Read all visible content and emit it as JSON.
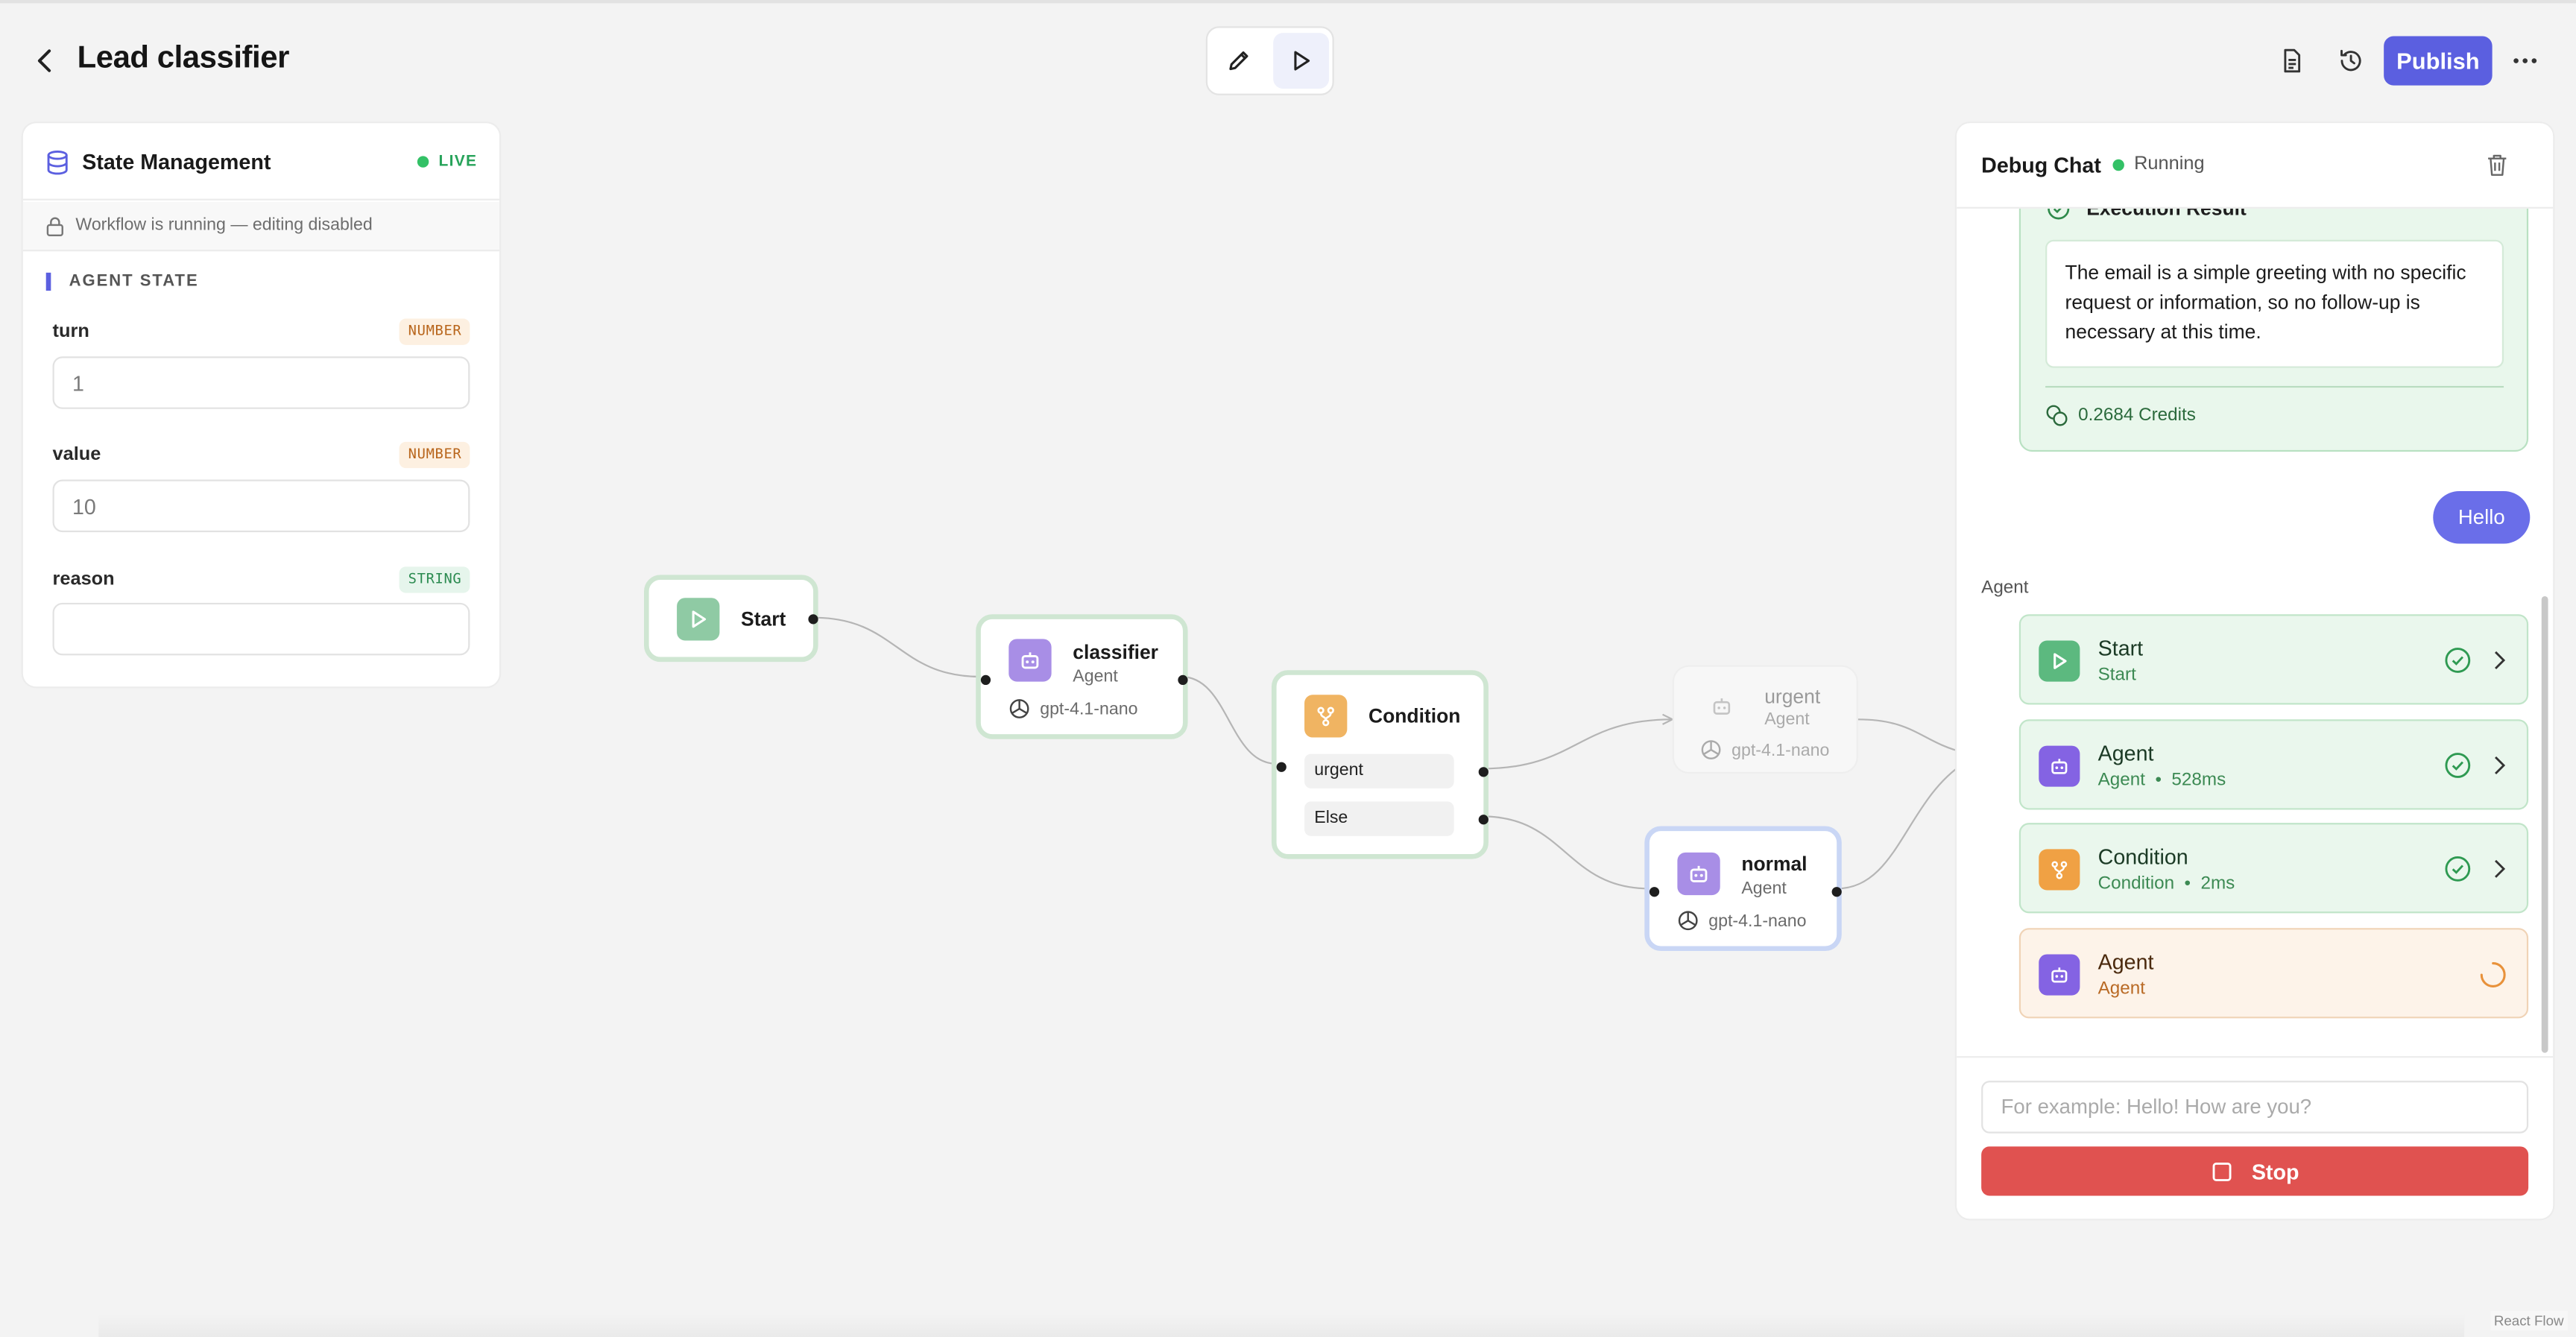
{
  "header": {
    "title": "Lead classifier",
    "publish_label": "Publish"
  },
  "state_panel": {
    "title": "State Management",
    "live_label": "LIVE",
    "lock_notice": "Workflow is running — editing disabled",
    "section_label": "AGENT STATE",
    "fields": [
      {
        "name": "turn",
        "type": "NUMBER",
        "value": "1"
      },
      {
        "name": "value",
        "type": "NUMBER",
        "value": "10"
      },
      {
        "name": "reason",
        "type": "STRING",
        "value": ""
      }
    ]
  },
  "canvas": {
    "nodes": {
      "start": {
        "name": "Start"
      },
      "classifier": {
        "name": "classifier",
        "sub": "Agent",
        "model": "gpt-4.1-nano"
      },
      "condition": {
        "name": "Condition",
        "branches": [
          "urgent",
          "Else"
        ]
      },
      "urgent": {
        "name": "urgent",
        "sub": "Agent",
        "model": "gpt-4.1-nano"
      },
      "normal": {
        "name": "normal",
        "sub": "Agent",
        "model": "gpt-4.1-nano"
      }
    },
    "attribution": "React Flow"
  },
  "debug": {
    "title": "Debug Chat",
    "status": "Running",
    "result_title": "Execution Result",
    "result_text": "The email is a simple greeting with no specific request or information, so no follow-up is necessary at this time.",
    "credits": "0.2684 Credits",
    "user_message": "Hello",
    "agent_label": "Agent",
    "steps": [
      {
        "name": "Start",
        "sub": "Start",
        "state": "done",
        "color": "#5cb97f",
        "icon": "play-icon"
      },
      {
        "name": "Agent",
        "sub": "Agent  •  528ms",
        "state": "done",
        "color": "#8463e3",
        "icon": "robot-icon"
      },
      {
        "name": "Condition",
        "sub": "Condition  •  2ms",
        "state": "done",
        "color": "#f0a144",
        "icon": "branch-icon"
      },
      {
        "name": "Agent",
        "sub": "Agent",
        "state": "running",
        "color": "#8463e3",
        "icon": "robot-icon"
      }
    ],
    "input_placeholder": "For example: Hello! How are you?",
    "stop_label": "Stop"
  },
  "colors": {
    "accent": "#5b5fe0",
    "success": "#33c166",
    "danger": "#e05250"
  }
}
